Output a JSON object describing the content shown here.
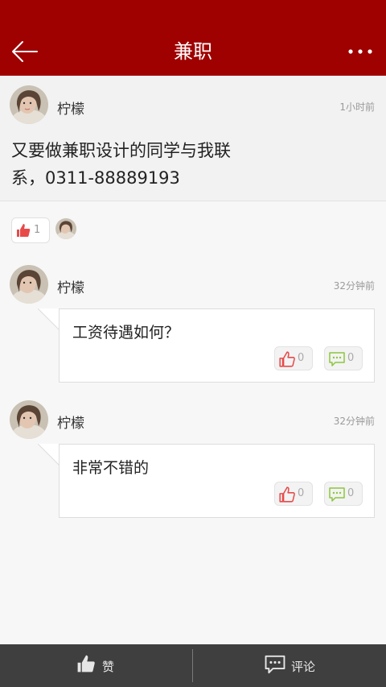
{
  "header": {
    "title": "兼职",
    "back_icon": "arrow-left-icon",
    "more_icon": "more-dots-icon",
    "background": "#9f0000"
  },
  "post": {
    "author": "柠檬",
    "time": "1小时前",
    "content": "又要做兼职设计的同学与我联系，0311-88889193",
    "like_count": "1"
  },
  "comments": [
    {
      "author": "柠檬",
      "time": "32分钟前",
      "text": "工资待遇如何？",
      "like_count": "0",
      "reply_count": "0"
    },
    {
      "author": "柠檬",
      "time": "32分钟前",
      "text": "非常不错的",
      "like_count": "0",
      "reply_count": "0"
    }
  ],
  "bottom_bar": {
    "like_label": "赞",
    "comment_label": "评论"
  },
  "colors": {
    "accent": "#9f0000",
    "like_red": "#e84a4a",
    "reply_green": "#8cc63e",
    "bottom_bar": "#3f3f3f"
  }
}
